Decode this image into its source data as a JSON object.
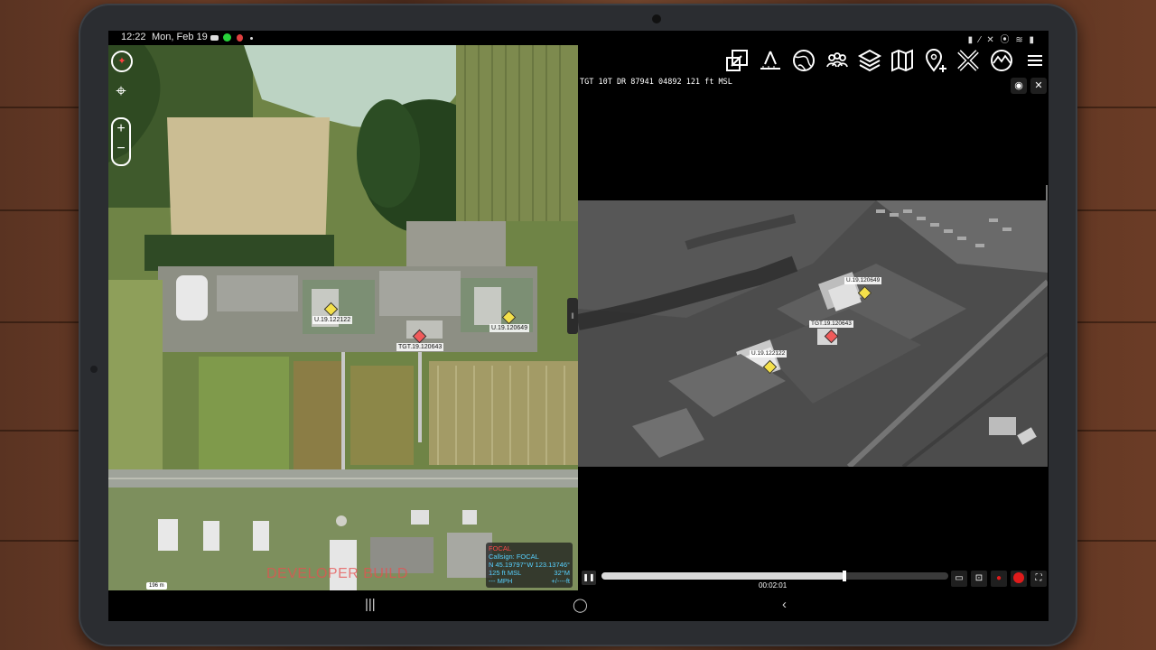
{
  "status_bar": {
    "time": "12:22",
    "date": "Mon, Feb 19"
  },
  "map": {
    "markers": [
      {
        "label": "U.19.122122",
        "color": "#f4e04a"
      },
      {
        "label": "U.19.120649",
        "color": "#f4e04a"
      },
      {
        "label": "TGT.19.120643",
        "color": "#f05a5a"
      }
    ],
    "scale_label": "196 m",
    "dev_banner": "DEVELOPER BUILD",
    "self_info": {
      "header": "FOCAL",
      "callsign": "Callsign: FOCAL",
      "lat": "N 45.19797°",
      "lon": "W 123.13746°",
      "alt": "125 ft MSL",
      "heading": "32°M",
      "speed": "--- MPH",
      "error": "+/----ft"
    }
  },
  "video": {
    "target_readout": "TGT  10T  DR  87941  04892 121  ft  MSL",
    "overlay_labels": [
      "U.19.120649",
      "TGT.19.120643",
      "U.19.122122"
    ],
    "timestamp": "00:02:01",
    "progress": 0.7
  },
  "toolbar": {
    "icons": [
      "external-screen-icon",
      "measure-icon",
      "globe-icon",
      "contacts-icon",
      "layers-icon",
      "map-icon",
      "add-point-icon",
      "close-tool-icon",
      "terrain-icon",
      "menu-icon"
    ]
  },
  "colors": {
    "accent": "#57d1ff",
    "record": "#e01b1b",
    "target": "#f05a5a",
    "unit": "#f4e04a"
  }
}
